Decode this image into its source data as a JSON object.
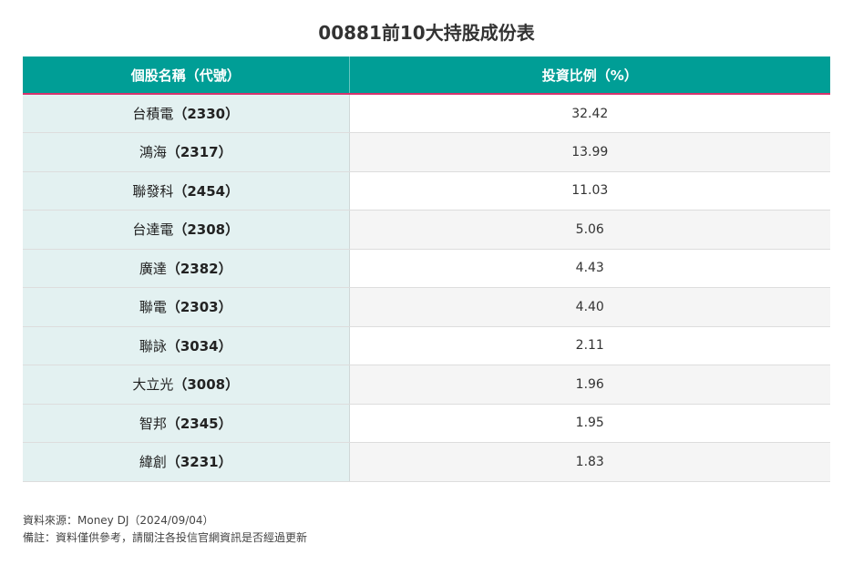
{
  "chart_data": {
    "type": "table",
    "title": "00881前10大持股成份表",
    "columns": [
      "個股名稱（代號）",
      "投資比例（%）"
    ],
    "rows": [
      {
        "name": "台積電",
        "code": "（2330）",
        "value": "32.42"
      },
      {
        "name": "鴻海",
        "code": "（2317）",
        "value": "13.99"
      },
      {
        "name": "聯發科",
        "code": "（2454）",
        "value": "11.03"
      },
      {
        "name": "台達電",
        "code": "（2308）",
        "value": "5.06"
      },
      {
        "name": "廣達",
        "code": "（2382）",
        "value": "4.43"
      },
      {
        "name": "聯電",
        "code": "（2303）",
        "value": "4.40"
      },
      {
        "name": "聯詠",
        "code": "（3034）",
        "value": "2.11"
      },
      {
        "name": "大立光",
        "code": "（3008）",
        "value": "1.96"
      },
      {
        "name": "智邦",
        "code": "（2345）",
        "value": "1.95"
      },
      {
        "name": "緯創",
        "code": "（3231）",
        "value": "1.83"
      }
    ]
  },
  "notes": {
    "source": "資料來源：Money DJ（2024/09/04）",
    "remark": "備註：資料僅供參考，請關注各投信官網資訊是否經過更新"
  },
  "colors": {
    "header_bg": "#009e96",
    "header_border": "#d6336c",
    "name_col_bg": "#e3f1f1"
  }
}
